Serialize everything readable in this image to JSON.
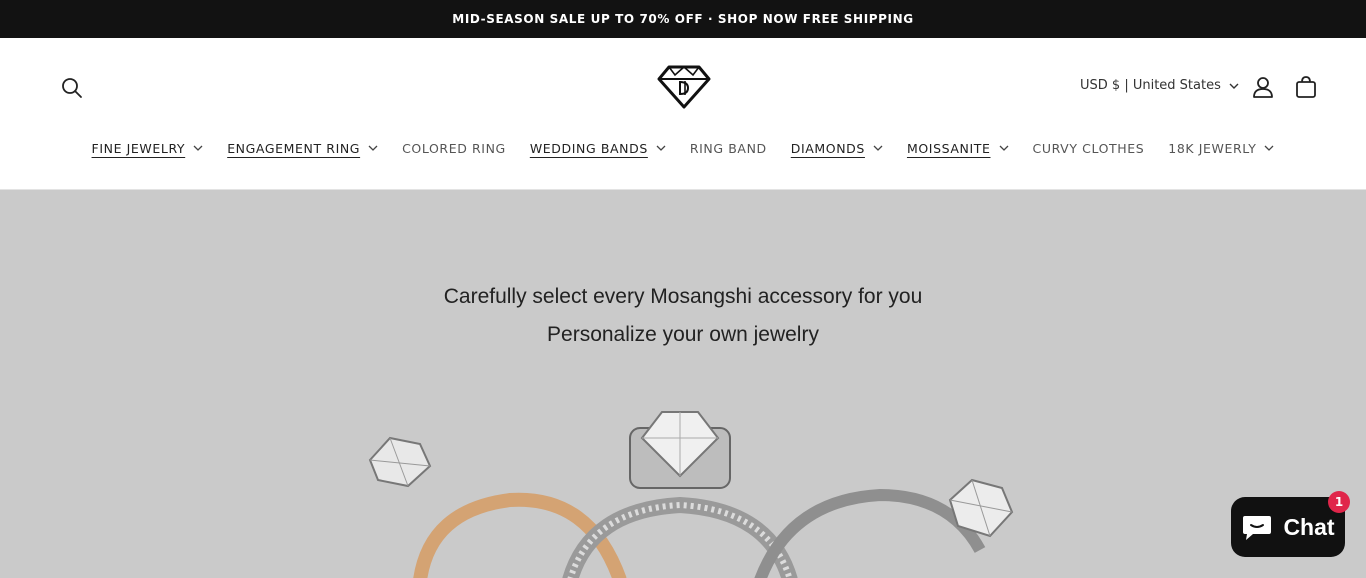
{
  "announcement": "MID-SEASON SALE UP TO 70% OFF · SHOP NOW FREE SHIPPING",
  "header": {
    "currency": "USD $ | United States",
    "icons": {
      "search": "search-icon",
      "account": "account-icon",
      "cart": "cart-icon",
      "logo": "diamond-logo"
    }
  },
  "nav": {
    "items": [
      {
        "label": "FINE JEWELRY",
        "has_dropdown": true,
        "active": true
      },
      {
        "label": "ENGAGEMENT RING",
        "has_dropdown": true,
        "active": true
      },
      {
        "label": "COLORED RING",
        "has_dropdown": false,
        "active": false
      },
      {
        "label": "WEDDING BANDS",
        "has_dropdown": true,
        "active": true
      },
      {
        "label": "RING BAND",
        "has_dropdown": false,
        "active": false
      },
      {
        "label": "DIAMONDS",
        "has_dropdown": true,
        "active": true
      },
      {
        "label": "MOISSANITE",
        "has_dropdown": true,
        "active": true
      },
      {
        "label": "CURVY CLOTHES",
        "has_dropdown": false,
        "active": false
      },
      {
        "label": "18K JEWERLY",
        "has_dropdown": true,
        "active": false
      }
    ]
  },
  "hero": {
    "line1": "Carefully select every Mosangshi accessory for you",
    "line2": "Personalize your own jewelry"
  },
  "chat": {
    "label": "Chat",
    "badge": "1"
  },
  "colors": {
    "announce_bg": "#121212",
    "hero_bg": "#cacaca",
    "chat_bg": "#111111",
    "badge": "#e0264a",
    "gold": "#d4a373"
  }
}
